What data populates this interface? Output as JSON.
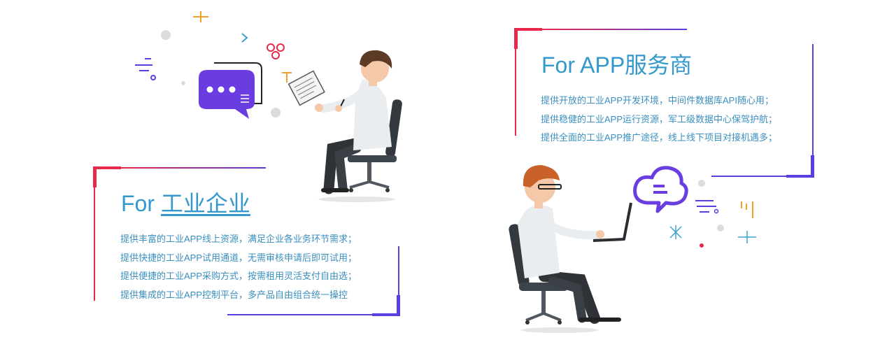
{
  "enterprise": {
    "title_prefix": "For ",
    "title_main": "工业企业",
    "lines": [
      "提供丰富的工业APP线上资源，满足企业各业务环节需求；",
      "提供快捷的工业APP试用通道，无需审核申请后即可试用；",
      "提供便捷的工业APP采购方式，按需租用灵活支付自由选；",
      "提供集成的工业APP控制平台，多产品自由组合统一操控"
    ]
  },
  "provider": {
    "title": "For APP服务商",
    "lines": [
      "提供开放的工业APP开发环境，中间件数据库API随心用；",
      "提供稳健的工业APP运行资源，军工级数据中心保驾护航；",
      "提供全面的工业APP推广途径，线上线下项目对接机遇多；"
    ]
  },
  "colors": {
    "title": "#3399cc",
    "text": "#3a8fbf",
    "accent_red": "#e8294b",
    "accent_purple": "#5b3de0",
    "accent_orange": "#f5a02a"
  },
  "icons": [
    "chat-bubble-icon",
    "cloud-chat-icon",
    "flower-icon",
    "plus-icon",
    "chevron-right-icon",
    "asterisk-icon",
    "lines-icon"
  ]
}
